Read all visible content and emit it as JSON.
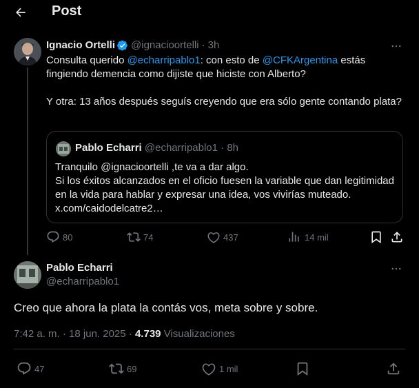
{
  "header": {
    "title": "Post"
  },
  "parent_tweet": {
    "name": "Ignacio Ortelli",
    "handle": "@ignacioortelli",
    "separator": "·",
    "time": "3h",
    "text": {
      "l1_a": "Consulta querido ",
      "l1_mention": "@echarripablo1",
      "l1_b": ": con esto de ",
      "l1_mention2": "@CFKArgentina",
      "l1_c": " estás fingiendo demencia como dijiste que hiciste con Alberto?",
      "l2": "Y otra: 13 años después seguís creyendo que era sólo gente contando plata?"
    },
    "quote": {
      "name": "Pablo Echarri",
      "handle": "@echarripablo1",
      "separator": "·",
      "time": "8h",
      "lines": [
        "Tranquilo @ignacioortelli ,te va a dar algo.",
        "Si los éxitos alcanzados en el oficio fuesen la variable que dan legitimidad en la vida para hablar y expresar una idea, vos vivirías muteado. x.com/caidodelcatre2…"
      ]
    },
    "stats": {
      "replies": "80",
      "reposts": "74",
      "likes": "437",
      "views": "14 mil"
    }
  },
  "main_tweet": {
    "name": "Pablo Echarri",
    "handle": "@echarripablo1",
    "text": "Creo que ahora la plata la contás vos, meta sobre y sobre.",
    "time": "7:42 a. m.",
    "separator": "·",
    "date": "18 jun. 2025",
    "views_count": "4.739",
    "views_label": "Visualizaciones",
    "stats": {
      "replies": "47",
      "reposts": "69",
      "likes": "1 mil"
    }
  },
  "colors": {
    "background": "#000000",
    "text": "#e7e9ea",
    "muted": "#71767b",
    "accent": "#1d9bf0",
    "border": "#2f3336"
  },
  "icons": [
    "back-arrow-icon",
    "verified-badge-icon",
    "more-icon",
    "reply-icon",
    "repost-icon",
    "like-icon",
    "views-icon",
    "bookmark-icon",
    "share-icon"
  ]
}
